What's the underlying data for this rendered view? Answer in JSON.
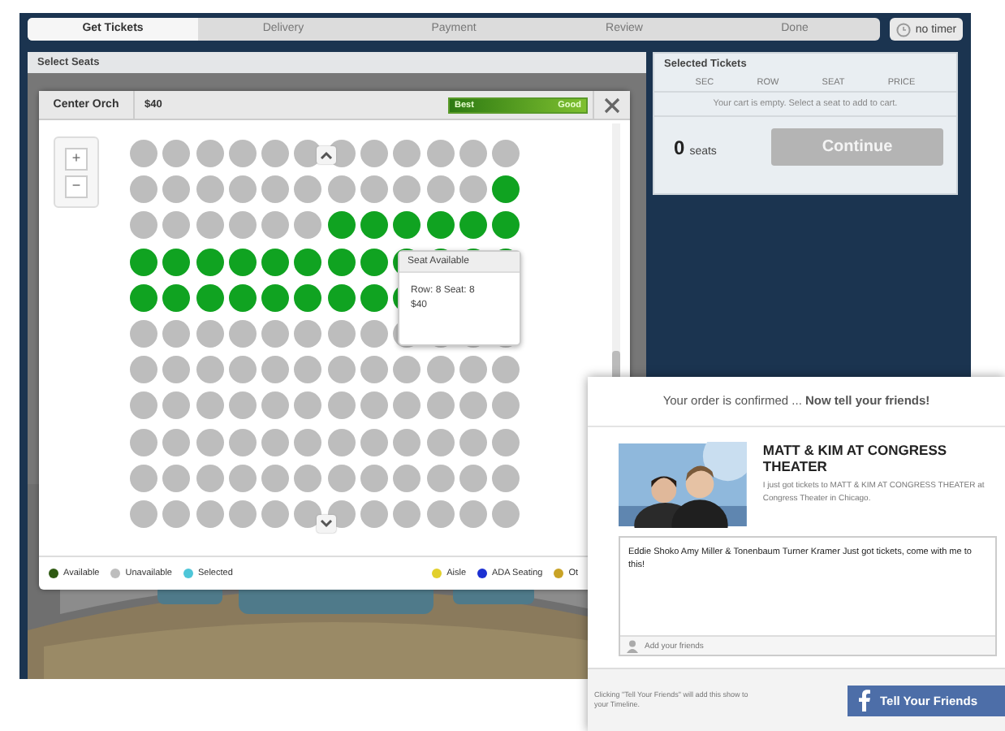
{
  "progress_tabs": [
    {
      "label": "Get Tickets",
      "selected": true
    },
    {
      "label": "Delivery",
      "selected": false
    },
    {
      "label": "Payment",
      "selected": false
    },
    {
      "label": "Review",
      "selected": false
    },
    {
      "label": "Done",
      "selected": false
    }
  ],
  "timer": {
    "label": "no timer"
  },
  "seat_panel": {
    "title": "Select Seats",
    "section": "Center Orch",
    "price": "$40",
    "price_scale": {
      "low_label": "Best",
      "high_label": "Good"
    },
    "zoom_buttons": [
      "+",
      "−"
    ],
    "seat_rows": [
      {
        "available": [
          false,
          false,
          false,
          false,
          false,
          false,
          false,
          false,
          false,
          false,
          false,
          false
        ]
      },
      {
        "available": [
          false,
          false,
          false,
          false,
          false,
          false,
          false,
          false,
          false,
          false,
          false,
          true
        ]
      },
      {
        "available": [
          false,
          false,
          false,
          false,
          false,
          false,
          true,
          true,
          true,
          true,
          true,
          true
        ]
      },
      {
        "available": [
          true,
          true,
          true,
          true,
          true,
          true,
          true,
          true,
          true,
          true,
          true,
          true
        ]
      },
      {
        "available": [
          true,
          true,
          true,
          true,
          true,
          true,
          true,
          true,
          true
        ]
      },
      {
        "available": [
          false,
          false,
          false,
          false,
          false,
          false,
          false,
          false,
          false,
          false,
          false,
          false
        ]
      },
      {
        "available": [
          false,
          false,
          false,
          false,
          false,
          false,
          false,
          false,
          false,
          false,
          false,
          false
        ]
      },
      {
        "available": [
          false,
          false,
          false,
          false,
          false,
          false,
          false,
          false,
          false,
          false,
          false,
          false
        ]
      },
      {
        "available": [
          false,
          false,
          false,
          false,
          false,
          false,
          false,
          false,
          false,
          false,
          false,
          false
        ]
      },
      {
        "available": [
          false,
          false,
          false,
          false,
          false,
          false,
          false,
          false,
          false,
          false,
          false,
          false
        ]
      },
      {
        "available": [
          false,
          false,
          false,
          false,
          false,
          false,
          false,
          false,
          false,
          false,
          false,
          false
        ]
      }
    ],
    "tooltip": {
      "title": "Seat Available",
      "detail": "Row: 8 Seat: 8",
      "price": "$40"
    },
    "legend_left": [
      {
        "label": "Available",
        "color": "#2f5a12"
      },
      {
        "label": "Unavailable",
        "color": "#bdbdbd"
      },
      {
        "label": "Selected",
        "color": "#4ec6d8"
      }
    ],
    "legend_right": [
      {
        "label": "Aisle",
        "color": "#e2d02c"
      },
      {
        "label": "ADA Seating",
        "color": "#1c30d2"
      },
      {
        "label": "Ot",
        "color": "#c9a326"
      }
    ]
  },
  "cart": {
    "title": "Selected Tickets",
    "columns": [
      "SEC",
      "ROW",
      "SEAT",
      "PRICE"
    ],
    "empty_message": "Your cart is empty. Select a seat to add to cart.",
    "seat_count": "0",
    "seat_unit": "seats",
    "continue_button": {
      "label": "Continue",
      "disabled": true
    }
  },
  "share_dialog": {
    "header": "Your order is confirmed ... **Now tell your friends!**",
    "event_title": "MATT & KIM AT CONGRESS THEATER",
    "description": "I just got tickets to MATT & KIM AT CONGRESS THEATER at Congress Theater in Chicago.",
    "message": "Eddie Shoko Amy Miller & Tonenbaum Turner Kramer  Just got tickets, come with me to this!",
    "friends_placeholder": "Add your friends",
    "footnote": "Clicking \"Tell Your Friends\" will add this show to your Timeline.",
    "share_button": "Tell Your Friends"
  }
}
